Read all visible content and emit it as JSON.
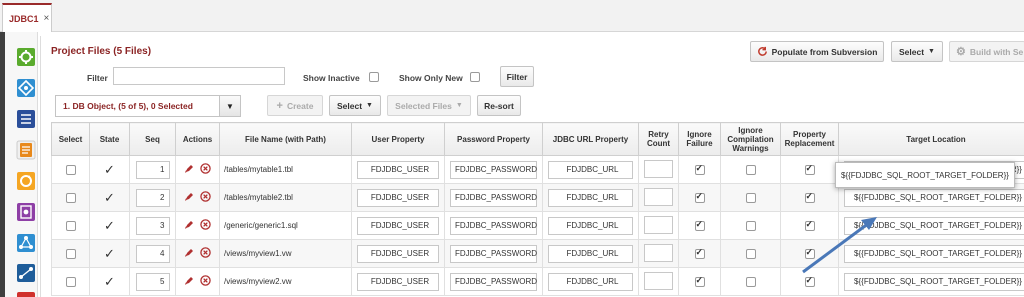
{
  "tab": {
    "label": "JDBC1",
    "close": "×"
  },
  "sidebar": {
    "icons": [
      "green-gear-icon",
      "blue-diamond-icon",
      "list-icon",
      "orange-document-icon",
      "orange-sync-icon",
      "purple-gear-doc-icon",
      "share-network-icon",
      "flow-diagram-icon",
      "red-icon"
    ]
  },
  "panel": {
    "title": "Project Files (5 Files)",
    "populate_label": "Populate from Subversion",
    "select_label": "Select",
    "build_label": "Build with Se"
  },
  "filters": {
    "filter_label": "Filter",
    "filter_value": "",
    "show_inactive_label": "Show Inactive",
    "show_only_new_label": "Show Only New",
    "filter_button": "Filter"
  },
  "toolbar": {
    "object_select": "1. DB Object, (5 of 5), 0 Selected",
    "create_label": "Create",
    "select_label": "Select",
    "selected_files_label": "Selected Files",
    "resort_label": "Re-sort"
  },
  "table": {
    "headers": [
      "Select",
      "State",
      "Seq",
      "Actions",
      "File Name (with Path)",
      "User Property",
      "Password Property",
      "JDBC URL Property",
      "Retry Count",
      "Ignore Failure",
      "Ignore Compilation Warnings",
      "Property Replacement",
      "Target Location"
    ],
    "rows": [
      {
        "seq": "1",
        "file": "/tables/mytable1.tbl",
        "user": "FDJDBC_USER",
        "password": "FDJDBC_PASSWORD",
        "url": "FDJDBC_URL",
        "retry": "",
        "ignore_failure": true,
        "ignore_warnings": false,
        "prop_replace": true,
        "target": "${{FDJDBC_SQL_ROOT_TARGET_FOLDER}}"
      },
      {
        "seq": "2",
        "file": "/tables/mytable2.tbl",
        "user": "FDJDBC_USER",
        "password": "FDJDBC_PASSWORD",
        "url": "FDJDBC_URL",
        "retry": "",
        "ignore_failure": true,
        "ignore_warnings": false,
        "prop_replace": true,
        "target": "${{FDJDBC_SQL_ROOT_TARGET_FOLDER}}"
      },
      {
        "seq": "3",
        "file": "/generic/generic1.sql",
        "user": "FDJDBC_USER",
        "password": "FDJDBC_PASSWORD",
        "url": "FDJDBC_URL",
        "retry": "",
        "ignore_failure": true,
        "ignore_warnings": false,
        "prop_replace": true,
        "target": "${{FDJDBC_SQL_ROOT_TARGET_FOLDER}}"
      },
      {
        "seq": "4",
        "file": "/views/myview1.vw",
        "user": "FDJDBC_USER",
        "password": "FDJDBC_PASSWORD",
        "url": "FDJDBC_URL",
        "retry": "",
        "ignore_failure": true,
        "ignore_warnings": false,
        "prop_replace": true,
        "target": "${{FDJDBC_SQL_ROOT_TARGET_FOLDER}}"
      },
      {
        "seq": "5",
        "file": "/views/myview2.vw",
        "user": "FDJDBC_USER",
        "password": "FDJDBC_PASSWORD",
        "url": "FDJDBC_URL",
        "retry": "",
        "ignore_failure": true,
        "ignore_warnings": false,
        "prop_replace": true,
        "target": "${{FDJDBC_SQL_ROOT_TARGET_FOLDER}}"
      }
    ]
  },
  "callout": {
    "text": "${{FDJDBC_SQL_ROOT_TARGET_FOLDER}}"
  },
  "colors": {
    "accent": "#8b2424",
    "arrow": "#4a78b8"
  }
}
